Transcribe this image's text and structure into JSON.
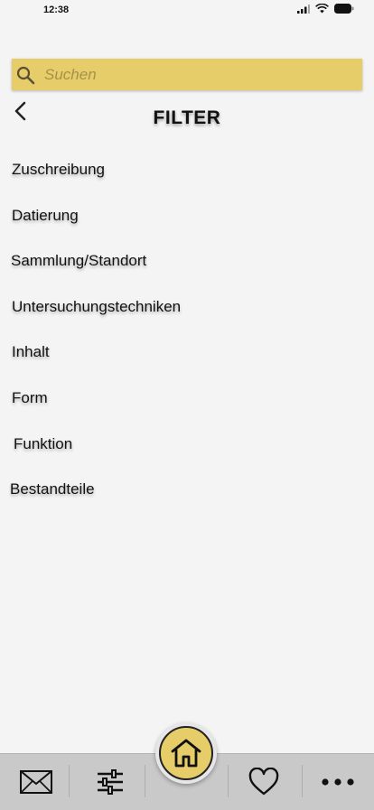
{
  "status": {
    "time": "12:38"
  },
  "search": {
    "placeholder": "Suchen"
  },
  "header": {
    "title": "FILTER"
  },
  "filters": [
    "Zuschreibung",
    "Datierung",
    "Sammlung/Standort",
    "Untersuchungstechniken",
    "Inhalt",
    "Form",
    "Funktion",
    "Bestandteile"
  ],
  "colors": {
    "accent": "#e6cd6a",
    "background": "#f4f4f4",
    "tabbar": "#c9c9c9"
  },
  "tabbar": {
    "icons": [
      "mail-icon",
      "sliders-icon",
      "home-icon",
      "heart-icon",
      "more-icon"
    ]
  }
}
